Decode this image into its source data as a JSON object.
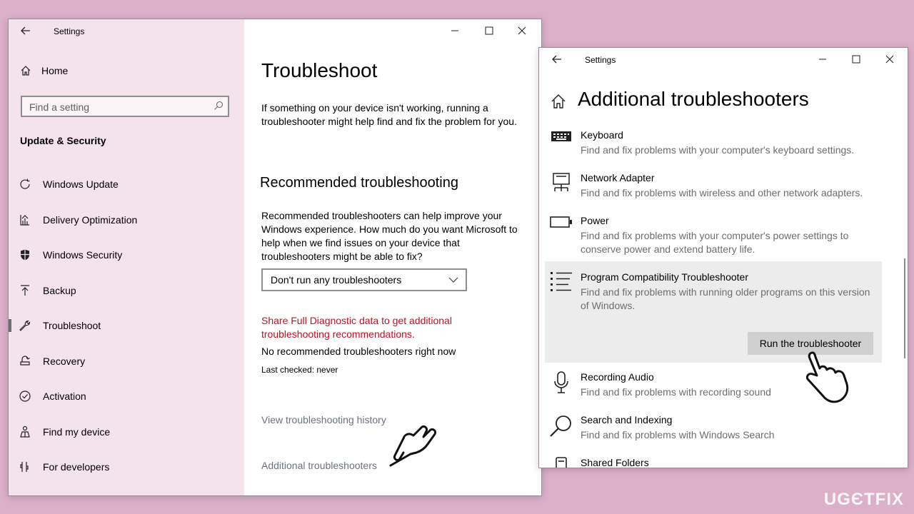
{
  "window1": {
    "title": "Settings",
    "sidebar": {
      "home": "Home",
      "search_placeholder": "Find a setting",
      "section": "Update & Security",
      "items": [
        {
          "label": "Windows Update",
          "icon": "refresh-icon"
        },
        {
          "label": "Delivery Optimization",
          "icon": "delivery-icon"
        },
        {
          "label": "Windows Security",
          "icon": "shield-icon"
        },
        {
          "label": "Backup",
          "icon": "backup-icon"
        },
        {
          "label": "Troubleshoot",
          "icon": "wrench-icon",
          "active": true
        },
        {
          "label": "Recovery",
          "icon": "recovery-icon"
        },
        {
          "label": "Activation",
          "icon": "check-circle-icon"
        },
        {
          "label": "Find my device",
          "icon": "person-icon"
        },
        {
          "label": "For developers",
          "icon": "developer-icon"
        }
      ]
    },
    "main": {
      "title": "Troubleshoot",
      "intro": "If something on your device isn't working, running a troubleshooter might help find and fix the problem for you.",
      "recommended_heading": "Recommended troubleshooting",
      "recommended_text": "Recommended troubleshooters can help improve your Windows experience. How much do you want Microsoft to help when we find issues on your device that troubleshooters might be able to fix?",
      "dropdown_value": "Don't run any troubleshooters",
      "diagnostic_link": "Share Full Diagnostic data to get additional troubleshooting recommendations.",
      "no_recommended": "No recommended troubleshooters right now",
      "last_checked": "Last checked: never",
      "history_link": "View troubleshooting history",
      "additional_link": "Additional troubleshooters"
    }
  },
  "window2": {
    "title": "Settings",
    "heading": "Additional troubleshooters",
    "items": [
      {
        "name": "Keyboard",
        "desc": "Find and fix problems with your computer's keyboard settings.",
        "icon": "keyboard-icon"
      },
      {
        "name": "Network Adapter",
        "desc": "Find and fix problems with wireless and other network adapters.",
        "icon": "network-icon"
      },
      {
        "name": "Power",
        "desc": "Find and fix problems with your computer's power settings to conserve power and extend battery life.",
        "icon": "battery-icon"
      },
      {
        "name": "Program Compatibility Troubleshooter",
        "desc": "Find and fix problems with running older programs on this version of Windows.",
        "icon": "list-icon",
        "selected": true
      },
      {
        "name": "Recording Audio",
        "desc": "Find and fix problems with recording sound",
        "icon": "microphone-icon"
      },
      {
        "name": "Search and Indexing",
        "desc": "Find and fix problems with Windows Search",
        "icon": "search-icon"
      },
      {
        "name": "Shared Folders",
        "desc": "",
        "icon": "server-icon"
      }
    ],
    "run_button": "Run the troubleshooter"
  },
  "watermark": "UGЄTFIX"
}
